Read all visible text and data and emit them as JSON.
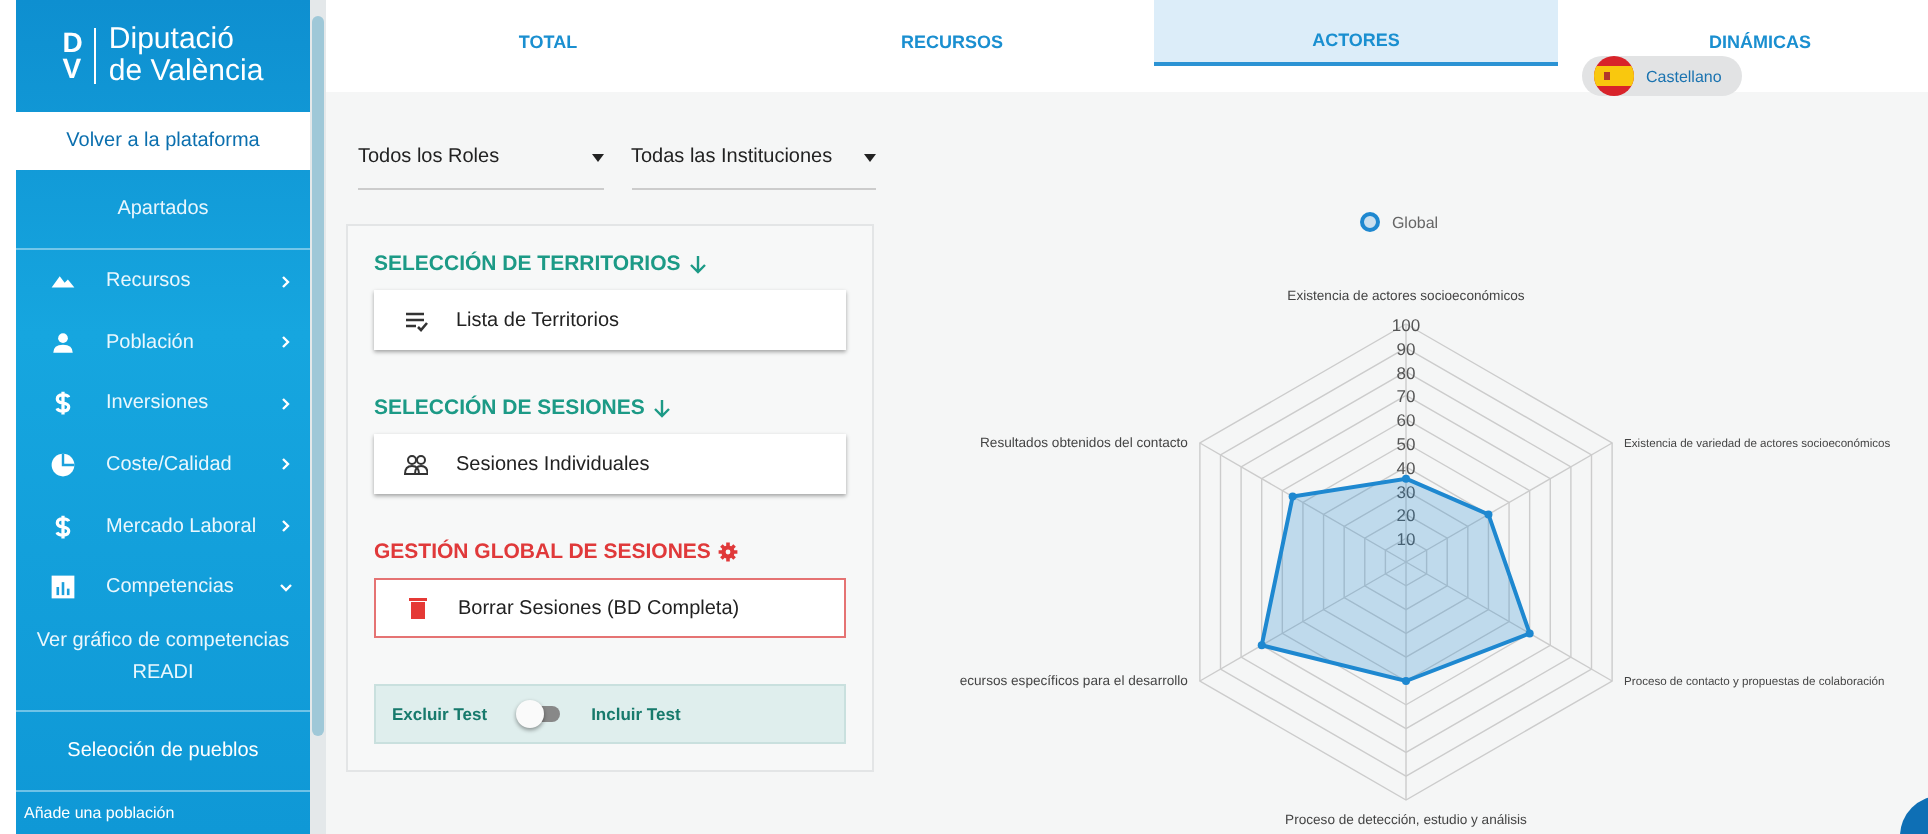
{
  "sidebar": {
    "logo": {
      "initials_top": "D",
      "initials_bottom": "V",
      "line1": "Diputació",
      "line2": "de València"
    },
    "back_link": "Volver a la plataforma",
    "section_title": "Apartados",
    "items": [
      {
        "label": "Recursos",
        "expanded": false
      },
      {
        "label": "Población",
        "expanded": false
      },
      {
        "label": "Inversiones",
        "expanded": false
      },
      {
        "label": "Coste/Calidad",
        "expanded": false
      },
      {
        "label": "Mercado Laboral",
        "expanded": false
      },
      {
        "label": "Competencias",
        "expanded": true,
        "children": [
          {
            "label": "Ver gráfico de competencias READI"
          }
        ]
      }
    ],
    "towns_title": "Seleoción de pueblos",
    "add_town": "Añade una población"
  },
  "tabs": [
    {
      "label": "TOTAL",
      "selected": false
    },
    {
      "label": "RECURSOS",
      "selected": false
    },
    {
      "label": "ACTORES",
      "selected": true
    },
    {
      "label": "DINÁMICAS",
      "selected": false
    }
  ],
  "language": {
    "label": "Castellano"
  },
  "filters": [
    {
      "value": "Todos los Roles"
    },
    {
      "value": "Todas las Instituciones"
    }
  ],
  "panel": {
    "sections": [
      {
        "kind": "territories",
        "title": "SELECCIÓN DE TERRITORIOS",
        "button": "Lista de Territorios"
      },
      {
        "kind": "sessions",
        "title": "SELECCIÓN DE SESIONES",
        "button": "Sesiones Individuales"
      },
      {
        "kind": "danger",
        "title": "GESTIÓN GLOBAL DE SESIONES",
        "button": "Borrar Sesiones (BD Completa)"
      }
    ],
    "toggle": {
      "off_label": "Excluir Test",
      "on_label": "Incluir Test",
      "on": false
    }
  },
  "chart": {
    "chart_data": {
      "type": "radar",
      "categories": [
        "Existencia de actores socioeconómicos",
        "Existencia de variedad de actores socioeconómicos",
        "Proceso de contacto y propuestas de colaboración",
        "Proceso de detección, estudio y análisis",
        "ecursos específicos para el desarrollo",
        "Resultados obtenidos del contacto"
      ],
      "series": [
        {
          "name": "Global",
          "color": "#1e88d0",
          "values": [
            35,
            40,
            60,
            50,
            70,
            55
          ]
        }
      ],
      "ylim": [
        0,
        100
      ],
      "yticks": [
        10,
        20,
        30,
        40,
        50,
        60,
        70,
        80,
        90,
        100
      ]
    }
  }
}
